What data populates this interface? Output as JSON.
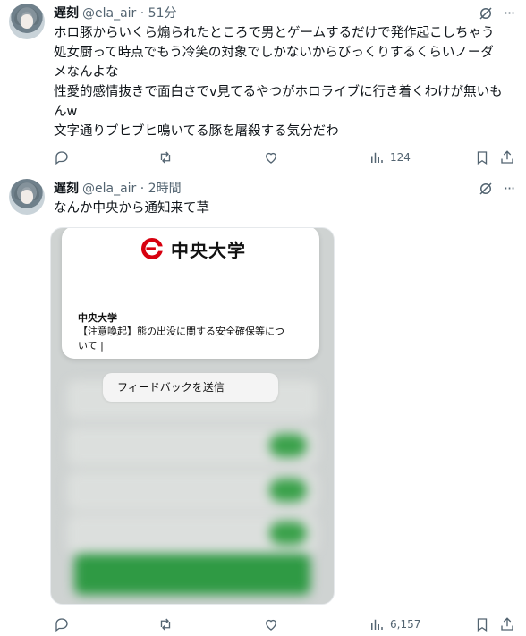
{
  "tweets": [
    {
      "display_name": "遅刻",
      "meta": "@ela_air · 51分",
      "lines": [
        "ホロ豚からいくら煽られたところで男とゲームするだけで発作起こしちゃう",
        "処女厨って時点でもう冷笑の対象でしかないからびっくりするくらいノーダ",
        "メなんよな",
        "性愛的感情抜きで面白さでv見てるやつがホロライブに行き着くわけが無いも",
        "んw",
        "文字通りブヒブヒ鳴いてる豚を屠殺する気分だわ"
      ],
      "views": "124"
    },
    {
      "display_name": "遅刻",
      "meta": "@ela_air · 2時間",
      "lines": [
        "なんか中央から通知来て草"
      ],
      "views": "6,157",
      "media": {
        "logo_text": "中央大学",
        "notification_sender": "中央大学",
        "notification_body": "【注意喚起】熊の出没に関する安全確保等について |",
        "feedback_label": "フィードバックを送信"
      }
    }
  ],
  "colors": {
    "text": "#0f1419",
    "muted": "#536471",
    "logo_red": "#d7000f",
    "toggle_green": "#3aa14a"
  },
  "icons": [
    "grok-icon",
    "more-icon",
    "reply-icon",
    "retweet-icon",
    "like-icon",
    "views-icon",
    "bookmark-icon",
    "share-icon"
  ]
}
